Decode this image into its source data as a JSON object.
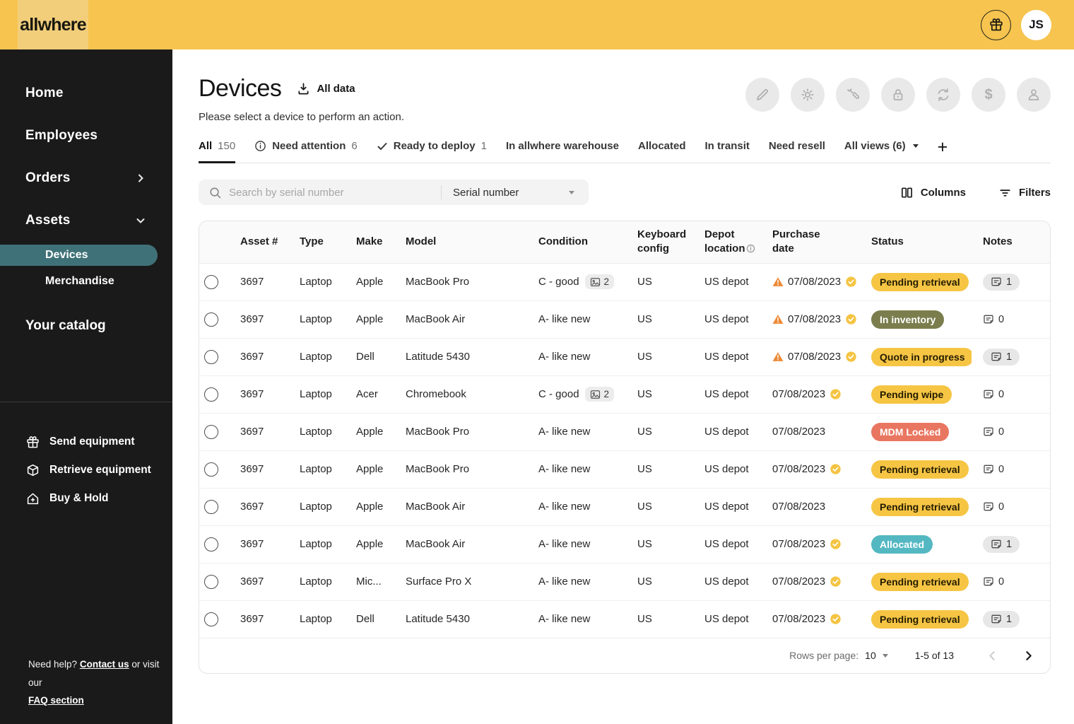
{
  "brand": {
    "logo": "allwhere",
    "avatar_initials": "JS"
  },
  "sidebar": {
    "nav": [
      {
        "label": "Home"
      },
      {
        "label": "Employees"
      },
      {
        "label": "Orders",
        "chevron": "right"
      },
      {
        "label": "Assets",
        "chevron": "down"
      }
    ],
    "sub": [
      {
        "label": "Devices",
        "active": true
      },
      {
        "label": "Merchandise",
        "active": false
      }
    ],
    "catalog_heading": "Your catalog",
    "catalog_items": [
      {
        "icon": "gift-icon",
        "label": "Send equipment"
      },
      {
        "icon": "box-icon",
        "label": "Retrieve equipment"
      },
      {
        "icon": "home-plus-icon",
        "label": "Buy & Hold"
      }
    ],
    "help": {
      "prefix": "Need help?",
      "contact_link": "Contact us",
      "middle": "or visit our",
      "faq_link": "FAQ section"
    }
  },
  "page": {
    "title": "Devices",
    "export_label": "All data",
    "subtitle": "Please select a device to perform an action.",
    "action_icons": [
      "edit",
      "settings",
      "repair",
      "lock",
      "recycle",
      "sell",
      "assign"
    ]
  },
  "tabs": [
    {
      "label": "All",
      "count": "150",
      "active": true
    },
    {
      "label": "Need attention",
      "count": "6",
      "icon": "info"
    },
    {
      "label": "Ready to deploy",
      "count": "1",
      "icon": "check"
    },
    {
      "label": "In allwhere warehouse"
    },
    {
      "label": "Allocated"
    },
    {
      "label": "In transit"
    },
    {
      "label": "Need resell"
    },
    {
      "label": "All views (6)",
      "caret": true
    }
  ],
  "toolbar": {
    "search_placeholder": "Search by serial number",
    "search_field": "Serial number",
    "columns_label": "Columns",
    "filters_label": "Filters"
  },
  "table": {
    "headers": [
      {
        "label": ""
      },
      {
        "label": "Asset #"
      },
      {
        "label": "Type"
      },
      {
        "label": "Make"
      },
      {
        "label": "Model"
      },
      {
        "label": "Condition"
      },
      {
        "label": "Keyboard config"
      },
      {
        "label": "Depot location",
        "info": true
      },
      {
        "label": "Purchase date",
        "narrow": true
      },
      {
        "label": "Status"
      },
      {
        "label": "Notes"
      }
    ],
    "rows": [
      {
        "asset": "3697",
        "type": "Laptop",
        "make": "Apple",
        "model": "MacBook Pro",
        "condition": "C - good",
        "images": "2",
        "keyboard": "US",
        "depot": "US depot",
        "date": "07/08/2023",
        "warning": true,
        "verified": true,
        "status": "Pending retrieval",
        "variant": "yellow",
        "notes": "1",
        "notes_pill": true
      },
      {
        "asset": "3697",
        "type": "Laptop",
        "make": "Apple",
        "model": "MacBook Air",
        "condition": "A- like new",
        "keyboard": "US",
        "depot": "US depot",
        "date": "07/08/2023",
        "warning": true,
        "verified": true,
        "status": "In inventory",
        "variant": "olive",
        "notes": "0",
        "notes_pill": false
      },
      {
        "asset": "3697",
        "type": "Laptop",
        "make": "Dell",
        "model": "Latitude 5430",
        "condition": "A- like new",
        "keyboard": "US",
        "depot": "US depot",
        "date": "07/08/2023",
        "warning": true,
        "verified": true,
        "status": "Quote in progress",
        "variant": "yellow",
        "notes": "1",
        "notes_pill": true
      },
      {
        "asset": "3697",
        "type": "Laptop",
        "make": "Acer",
        "model": "Chromebook",
        "condition": "C - good",
        "images": "2",
        "keyboard": "US",
        "depot": "US depot",
        "date": "07/08/2023",
        "warning": false,
        "verified": true,
        "status": "Pending wipe",
        "variant": "yellow",
        "notes": "0",
        "notes_pill": false
      },
      {
        "asset": "3697",
        "type": "Laptop",
        "make": "Apple",
        "model": "MacBook Pro",
        "condition": "A- like new",
        "keyboard": "US",
        "depot": "US depot",
        "date": "07/08/2023",
        "warning": false,
        "verified": false,
        "status": "MDM Locked",
        "variant": "red",
        "notes": "0",
        "notes_pill": false
      },
      {
        "asset": "3697",
        "type": "Laptop",
        "make": "Apple",
        "model": "MacBook Pro",
        "condition": "A- like new",
        "keyboard": "US",
        "depot": "US depot",
        "date": "07/08/2023",
        "warning": false,
        "verified": true,
        "status": "Pending retrieval",
        "variant": "yellow",
        "notes": "0",
        "notes_pill": false
      },
      {
        "asset": "3697",
        "type": "Laptop",
        "make": "Apple",
        "model": "MacBook Air",
        "condition": "A- like new",
        "keyboard": "US",
        "depot": "US depot",
        "date": "07/08/2023",
        "warning": false,
        "verified": false,
        "status": "Pending retrieval",
        "variant": "yellow",
        "notes": "0",
        "notes_pill": false
      },
      {
        "asset": "3697",
        "type": "Laptop",
        "make": "Apple",
        "model": "MacBook Air",
        "condition": "A- like new",
        "keyboard": "US",
        "depot": "US depot",
        "date": "07/08/2023",
        "warning": false,
        "verified": true,
        "status": "Allocated",
        "variant": "teal",
        "notes": "1",
        "notes_pill": true
      },
      {
        "asset": "3697",
        "type": "Laptop",
        "make": "Mic...",
        "model": "Surface Pro X",
        "condition": "A- like new",
        "keyboard": "US",
        "depot": "US depot",
        "date": "07/08/2023",
        "warning": false,
        "verified": true,
        "status": "Pending retrieval",
        "variant": "yellow",
        "notes": "0",
        "notes_pill": false
      },
      {
        "asset": "3697",
        "type": "Laptop",
        "make": "Dell",
        "model": "Latitude 5430",
        "condition": "A- like new",
        "keyboard": "US",
        "depot": "US depot",
        "date": "07/08/2023",
        "warning": false,
        "verified": true,
        "status": "Pending retrieval",
        "variant": "yellow",
        "notes": "1",
        "notes_pill": true
      }
    ]
  },
  "pagination": {
    "rows_per_page_label": "Rows per page:",
    "rows_per_page": "10",
    "range": "1-5 of 13"
  },
  "colors": {
    "header_bg": "#F6C44F",
    "sidebar_bg": "#1A1A1A",
    "active_pill": "#3F7278",
    "status_yellow": "#F6C544",
    "status_olive": "#7B7D4D",
    "status_red": "#E97660",
    "status_teal": "#54B8C2",
    "warning_orange": "#ED8936"
  }
}
